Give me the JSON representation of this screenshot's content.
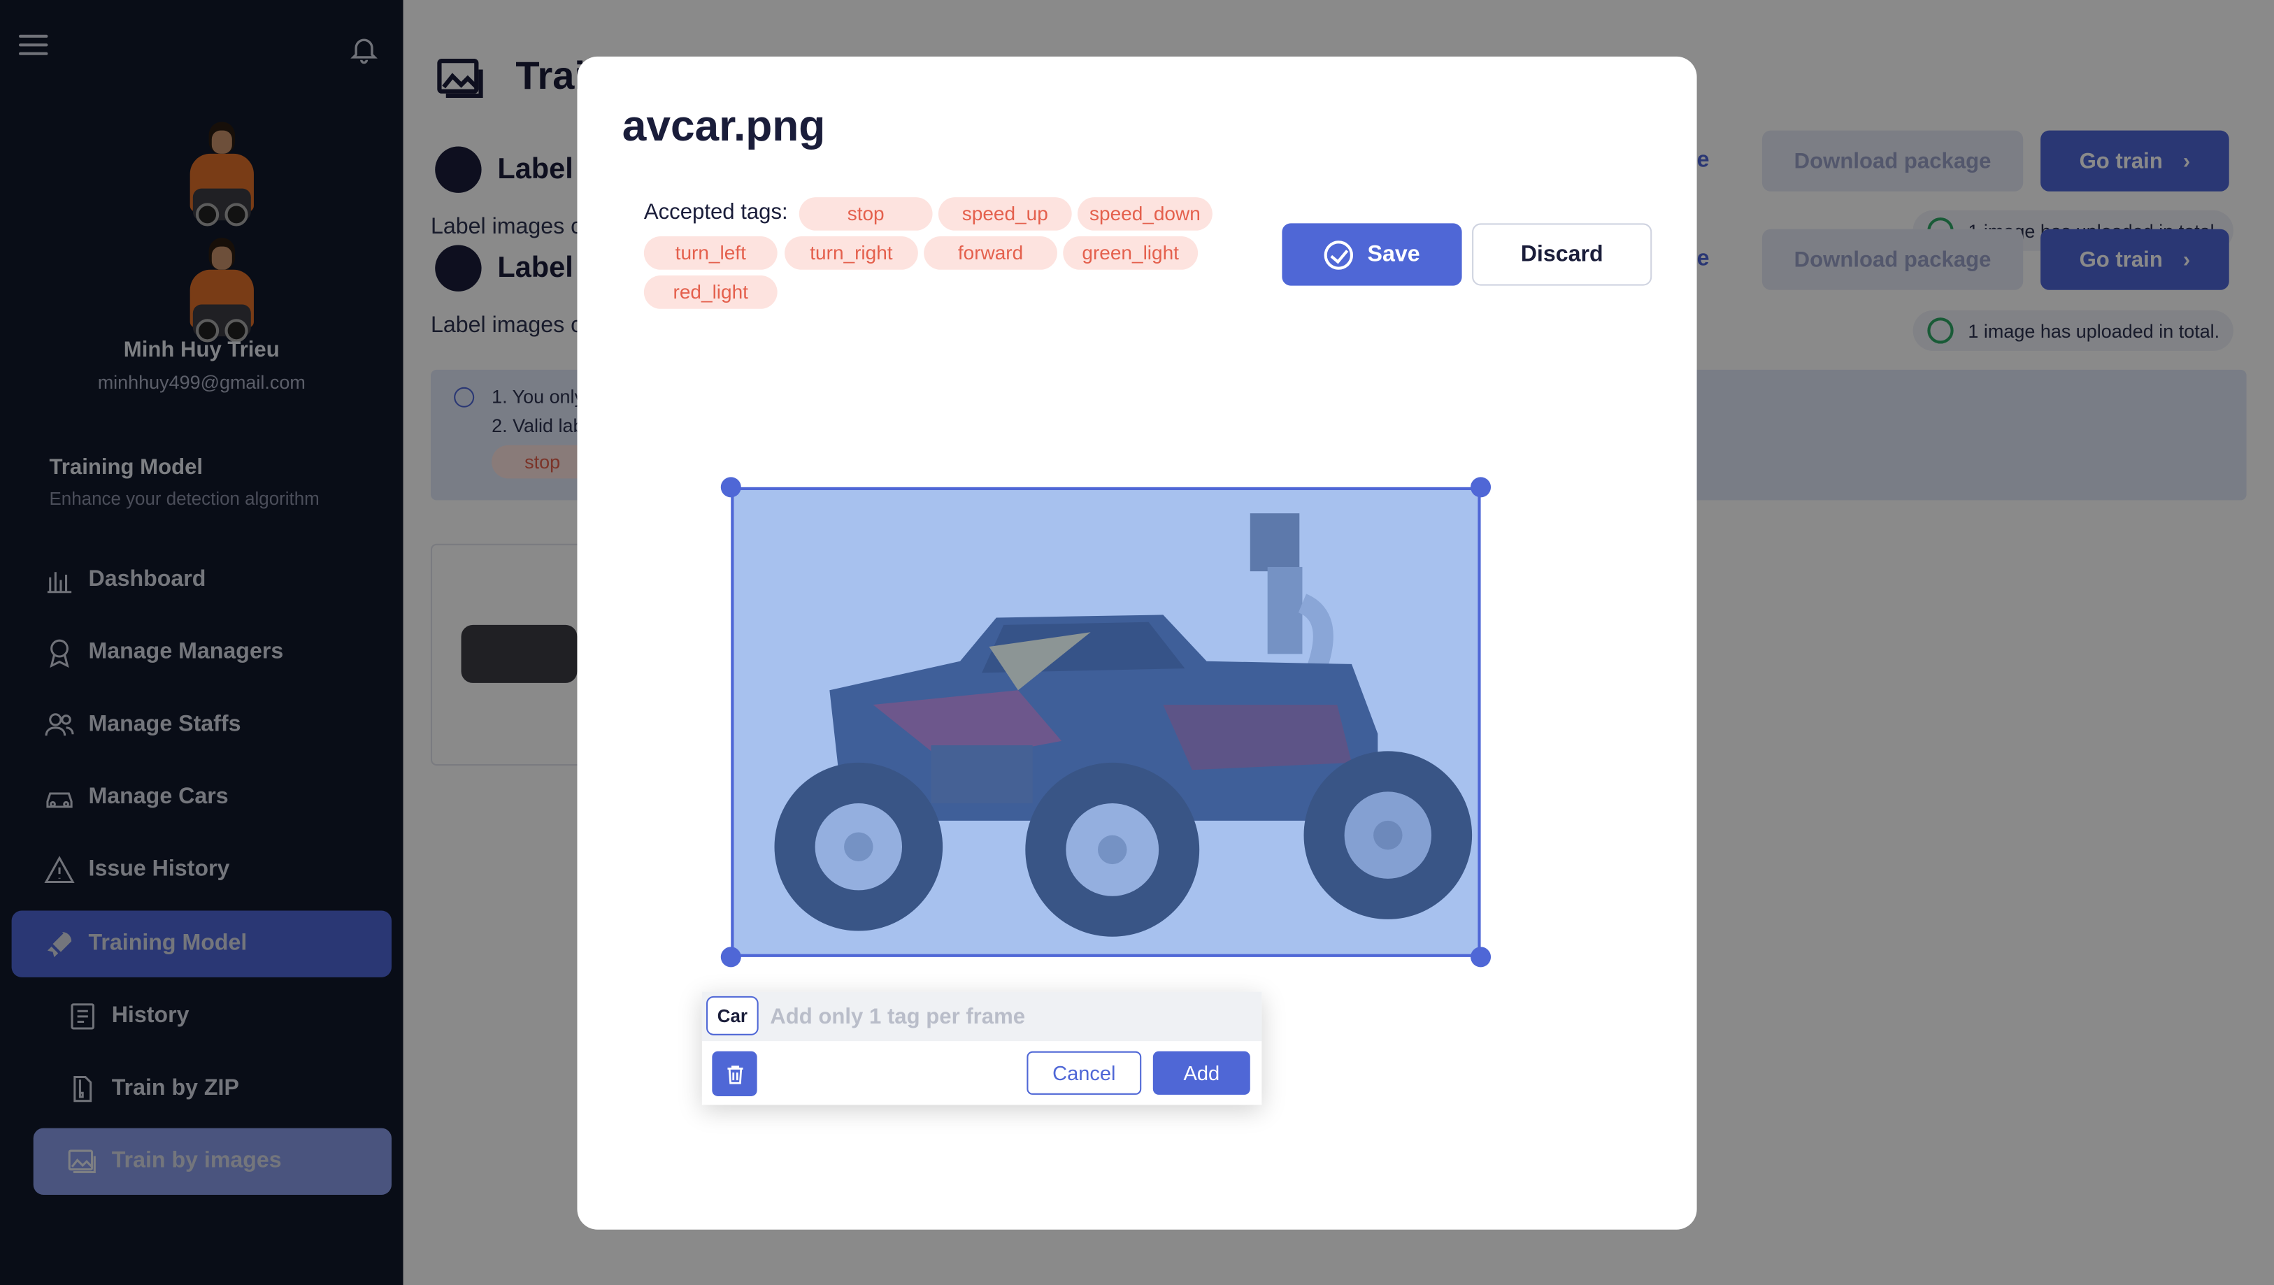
{
  "sidebar": {
    "user_name": "Minh Huy Trieu",
    "user_email": "minhhuy499@gmail.com",
    "section_title": "Training Model",
    "section_subtitle": "Enhance your detection algorithm",
    "items": [
      {
        "label": "Dashboard",
        "icon": "bar-chart-icon"
      },
      {
        "label": "Manage Managers",
        "icon": "badge-icon"
      },
      {
        "label": "Manage Staffs",
        "icon": "users-icon"
      },
      {
        "label": "Manage Cars",
        "icon": "car-icon"
      },
      {
        "label": "Issue History",
        "icon": "warning-icon"
      },
      {
        "label": "Training Model",
        "icon": "rocket-icon",
        "active": true
      }
    ],
    "subitems": [
      {
        "label": "History",
        "icon": "document-icon"
      },
      {
        "label": "Train by ZIP",
        "icon": "zip-file-icon"
      },
      {
        "label": "Train by images",
        "icon": "images-icon",
        "active": true
      }
    ]
  },
  "background": {
    "title": "Trai",
    "label1": "Label",
    "label2": "Label",
    "desc1": "Label images c",
    "desc2": "Label images c",
    "info_line1": "1. You only",
    "info_line2": "2. Valid lab",
    "info_tag": "stop",
    "right_fragment": "re",
    "download_label": "Download package",
    "go_train_label": "Go train",
    "upload_note": "1 image has uploaded in total."
  },
  "modal": {
    "title": "avcar.png",
    "accepted_tags_label": "Accepted tags:",
    "tags": [
      "stop",
      "speed_up",
      "speed_down",
      "turn_left",
      "turn_right",
      "forward",
      "green_light",
      "red_light"
    ],
    "save_label": "Save",
    "discard_label": "Discard"
  },
  "popup": {
    "current_tag": "Car",
    "input_value": "",
    "placeholder": "Add only 1 tag per frame",
    "cancel_label": "Cancel",
    "add_label": "Add"
  },
  "colors": {
    "accent": "#4f67d6",
    "sidebar_bg": "#12182b",
    "tag_bg": "#fde3df",
    "tag_text": "#e4604d"
  }
}
